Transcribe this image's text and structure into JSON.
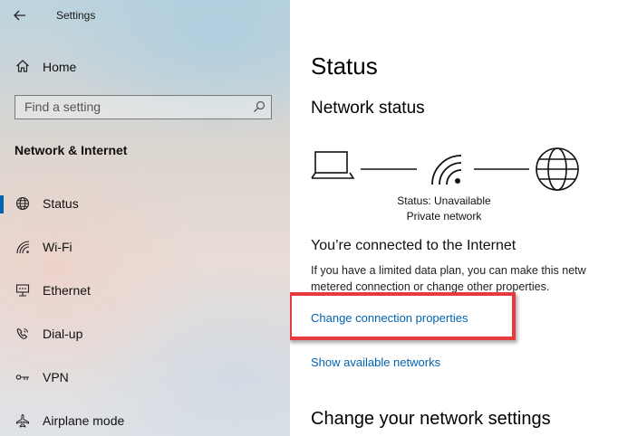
{
  "app": {
    "title": "Settings"
  },
  "sidebar": {
    "home_label": "Home",
    "search_placeholder": "Find a setting",
    "section_title": "Network & Internet",
    "items": [
      {
        "label": "Status",
        "icon": "globe-icon",
        "selected": true
      },
      {
        "label": "Wi-Fi",
        "icon": "wifi-icon",
        "selected": false
      },
      {
        "label": "Ethernet",
        "icon": "ethernet-icon",
        "selected": false
      },
      {
        "label": "Dial-up",
        "icon": "dialup-icon",
        "selected": false
      },
      {
        "label": "VPN",
        "icon": "vpn-icon",
        "selected": false
      },
      {
        "label": "Airplane mode",
        "icon": "airplane-icon",
        "selected": false
      }
    ]
  },
  "main": {
    "page_title": "Status",
    "network_status_heading": "Network status",
    "diagram": {
      "status_line": "Status: Unavailable",
      "network_type": "Private network"
    },
    "connected_heading": "You’re connected to the Internet",
    "description_line1": "If you have a limited data plan, you can make this netw",
    "description_line2": "metered connection or change other properties.",
    "link_change": "Change connection properties",
    "link_show": "Show available networks",
    "change_settings_heading": "Change your network settings"
  },
  "colors": {
    "accent": "#0063b1",
    "highlight": "#e63a40"
  }
}
